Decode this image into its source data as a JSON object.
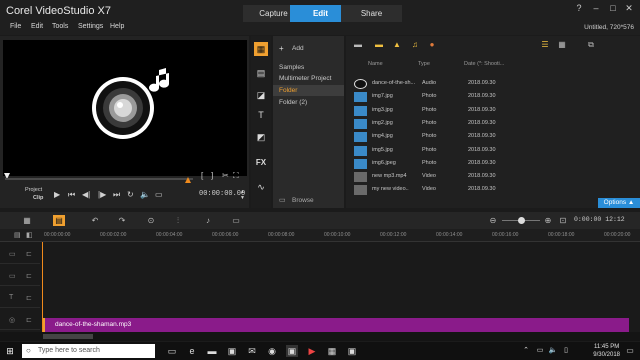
{
  "app": {
    "title": "Corel VideoStudio X7",
    "project_info": "Untitled, 720*576"
  },
  "tabs": [
    {
      "label": "Capture"
    },
    {
      "label": "Edit"
    },
    {
      "label": "Share"
    }
  ],
  "window_controls": {
    "help": "?",
    "minimize": "–",
    "maximize": "□",
    "close": "✕"
  },
  "menu": [
    {
      "label": "File"
    },
    {
      "label": "Edit"
    },
    {
      "label": "Tools"
    },
    {
      "label": "Settings"
    },
    {
      "label": "Help"
    }
  ],
  "preview": {
    "mode_label": "Project",
    "mode_sub": "Clip",
    "timecode": "00:00:00.00",
    "playhead_fraction": 0.0,
    "bracket_in": "[",
    "bracket_out": "]"
  },
  "library": {
    "add_label": "Add",
    "browse_label": "Browse",
    "tree": [
      {
        "label": "Samples"
      },
      {
        "label": "Multimeter Project"
      },
      {
        "label": "Folder"
      },
      {
        "label": "Folder (2)"
      }
    ],
    "selected_tree_index": 2,
    "columns": [
      "Name",
      "Type",
      "Date (*: Shooti..."
    ],
    "rows": [
      {
        "name": "dance-of-the-sh...",
        "type": "Audio",
        "date": "2018.09.30",
        "kind": "audio"
      },
      {
        "name": "img7.jpg",
        "type": "Photo",
        "date": "2018.09.30",
        "kind": "photo"
      },
      {
        "name": "img3.jpg",
        "type": "Photo",
        "date": "2018.09.30",
        "kind": "photo"
      },
      {
        "name": "img2.jpg",
        "type": "Photo",
        "date": "2018.09.30",
        "kind": "photo"
      },
      {
        "name": "img4.jpg",
        "type": "Photo",
        "date": "2018.09.30",
        "kind": "photo"
      },
      {
        "name": "img5.jpg",
        "type": "Photo",
        "date": "2018.09.30",
        "kind": "photo"
      },
      {
        "name": "img6.jpeg",
        "type": "Photo",
        "date": "2018.09.30",
        "kind": "photo"
      },
      {
        "name": "new mp3.mp4",
        "type": "Video",
        "date": "2018.09.30",
        "kind": "video"
      },
      {
        "name": "my new video..",
        "type": "Video",
        "date": "2018.09.30",
        "kind": "video"
      }
    ],
    "options_label": "Options ▲"
  },
  "timeline": {
    "zoom_time": "0:00:00 12:12",
    "ticks": [
      "00:00:00:00",
      "00:00:02:00",
      "00:00:04:00",
      "00:00:06:00",
      "00:00:08:00",
      "00:00:10:00",
      "00:00:12:00",
      "00:00:14:00",
      "00:00:16:00",
      "00:00:18:00",
      "00:00:20:00"
    ],
    "audio_clip_label": "dance-of-the-shaman.mp3"
  },
  "taskbar": {
    "search_placeholder": "Type here to search",
    "time": "11:45 PM",
    "date": "9/30/2018"
  },
  "colors": {
    "accent": "#2a8ed8",
    "clip": "#8a1b8a",
    "playhead": "#f08a1c"
  }
}
